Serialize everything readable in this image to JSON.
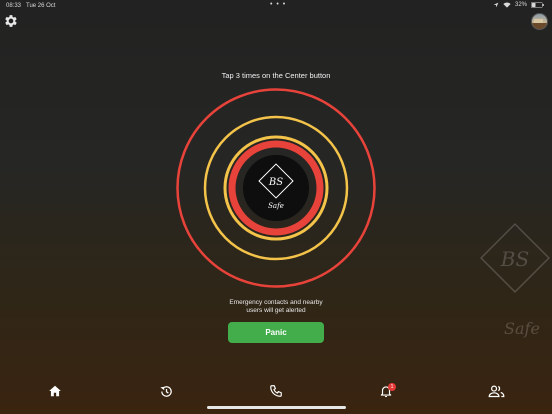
{
  "status_bar": {
    "time": "08:33",
    "date": "Tue 26 Oct",
    "battery": "32%",
    "dots": "• • •"
  },
  "main": {
    "instruction": "Tap 3 times on the Center button",
    "logo_text": "BS",
    "logo_script": "Safe",
    "alert_line1": "Emergency contacts and nearby",
    "alert_line2": "users will get alerted",
    "panic_label": "Panic"
  },
  "watermark": {
    "text": "BS",
    "script": "Safe"
  },
  "tab_bar": {
    "tabs": [
      {
        "icon": "home-icon"
      },
      {
        "icon": "history-icon"
      },
      {
        "icon": "phone-icon"
      },
      {
        "icon": "bell-icon",
        "badge": "1"
      },
      {
        "icon": "contacts-icon"
      }
    ]
  },
  "colors": {
    "outer_ring": "#e8433a",
    "yellow_ring": "#f3c34a",
    "inner_ring": "#e8433a",
    "panic_green": "#43ad4c",
    "badge_red": "#e53935"
  }
}
